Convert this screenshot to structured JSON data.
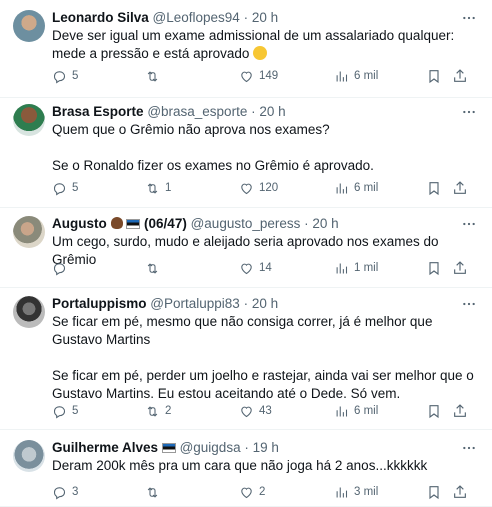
{
  "tweets": [
    {
      "name": "Leonardo Silva",
      "handle": "@Leoflopes94",
      "dot": "·",
      "time": "20 h",
      "text": [
        "Deve ser igual um exame admissional de um assalariado qualquer: mede a pressão e está aprovado"
      ],
      "emoji": "laughing-tears-emoji",
      "replies": "5",
      "retweets": "",
      "likes": "149",
      "views": "6 mil"
    },
    {
      "name": "Brasa Esporte",
      "handle": "@brasa_esporte",
      "dot": "·",
      "time": "20 h",
      "text": [
        "Quem que o Grêmio  não aprova nos exames?",
        "Se o Ronaldo fizer os exames no Grêmio é aprovado."
      ],
      "replies": "5",
      "retweets": "1",
      "likes": "120",
      "views": "6 mil"
    },
    {
      "name": "Augusto",
      "name_suffix": "(06/47)",
      "handle": "@augusto_peress",
      "dot": "·",
      "time": "20 h",
      "text": [
        "Um cego, surdo, mudo e aleijado seria aprovado nos exames do Grêmio"
      ],
      "replies": "",
      "retweets": "",
      "likes": "14",
      "views": "1 mil"
    },
    {
      "name": "Portaluppismo",
      "handle": "@Portaluppi83",
      "dot": "·",
      "time": "20 h",
      "text": [
        "Se ficar em pé, mesmo que não consiga correr, já é melhor que Gustavo Martins",
        "Se ficar em pé, perder um joelho e rastejar, ainda vai ser melhor que o Gustavo Martins. Eu estou aceitando até o Dede. Só vem."
      ],
      "replies": "5",
      "retweets": "2",
      "likes": "43",
      "views": "6 mil"
    },
    {
      "name": "Guilherme Alves",
      "handle": "@guigdsa",
      "dot": "·",
      "time": "19 h",
      "text": [
        "Deram 200k mês pra um cara que não joga há 2 anos...kkkkkk"
      ],
      "replies": "3",
      "retweets": "",
      "likes": "2",
      "views": "3 mil"
    }
  ],
  "colors": {
    "text": "#0f1419",
    "secondary": "#536471",
    "divider": "#eff3f4"
  },
  "icons": [
    "reply-icon",
    "retweet-icon",
    "like-icon",
    "views-icon",
    "bookmark-icon",
    "share-icon",
    "more-icon"
  ]
}
